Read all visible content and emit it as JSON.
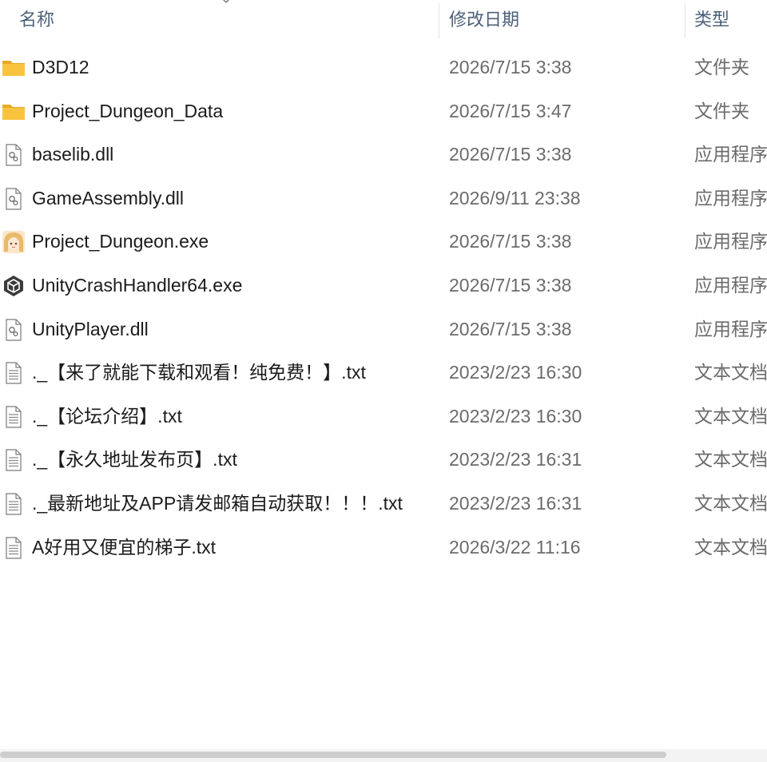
{
  "columns": {
    "name": "名称",
    "date_modified": "修改日期",
    "type": "类型"
  },
  "files": [
    {
      "name": "D3D12",
      "date": "2026/7/15 3:38",
      "type": "文件夹",
      "icon": "folder-icon"
    },
    {
      "name": "Project_Dungeon_Data",
      "date": "2026/7/15 3:47",
      "type": "文件夹",
      "icon": "folder-icon"
    },
    {
      "name": "baselib.dll",
      "date": "2026/7/15 3:38",
      "type": "应用程序",
      "icon": "dll-file-icon"
    },
    {
      "name": "GameAssembly.dll",
      "date": "2026/9/11 23:38",
      "type": "应用程序",
      "icon": "dll-file-icon"
    },
    {
      "name": "Project_Dungeon.exe",
      "date": "2026/7/15 3:38",
      "type": "应用程序",
      "icon": "game-app-icon"
    },
    {
      "name": "UnityCrashHandler64.exe",
      "date": "2026/7/15 3:38",
      "type": "应用程序",
      "icon": "unity-app-icon"
    },
    {
      "name": "UnityPlayer.dll",
      "date": "2026/7/15 3:38",
      "type": "应用程序",
      "icon": "dll-file-icon"
    },
    {
      "name": "._【来了就能下载和观看！纯免费！】.txt",
      "date": "2023/2/23 16:30",
      "type": "文本文档",
      "icon": "text-file-icon"
    },
    {
      "name": "._【论坛介绍】.txt",
      "date": "2023/2/23 16:30",
      "type": "文本文档",
      "icon": "text-file-icon"
    },
    {
      "name": "._【永久地址发布页】.txt",
      "date": "2023/2/23 16:31",
      "type": "文本文档",
      "icon": "text-file-icon"
    },
    {
      "name": "._最新地址及APP请发邮箱自动获取！！！.txt",
      "date": "2023/2/23 16:31",
      "type": "文本文档",
      "icon": "text-file-icon"
    },
    {
      "name": "A好用又便宜的梯子.txt",
      "date": "2026/3/22 11:16",
      "type": "文本文档",
      "icon": "text-file-icon"
    }
  ],
  "colors": {
    "header_text": "#4c607a",
    "name_text": "#1b1b1b",
    "meta_text": "#6b6b6b",
    "folder_yellow": "#f8c440"
  }
}
